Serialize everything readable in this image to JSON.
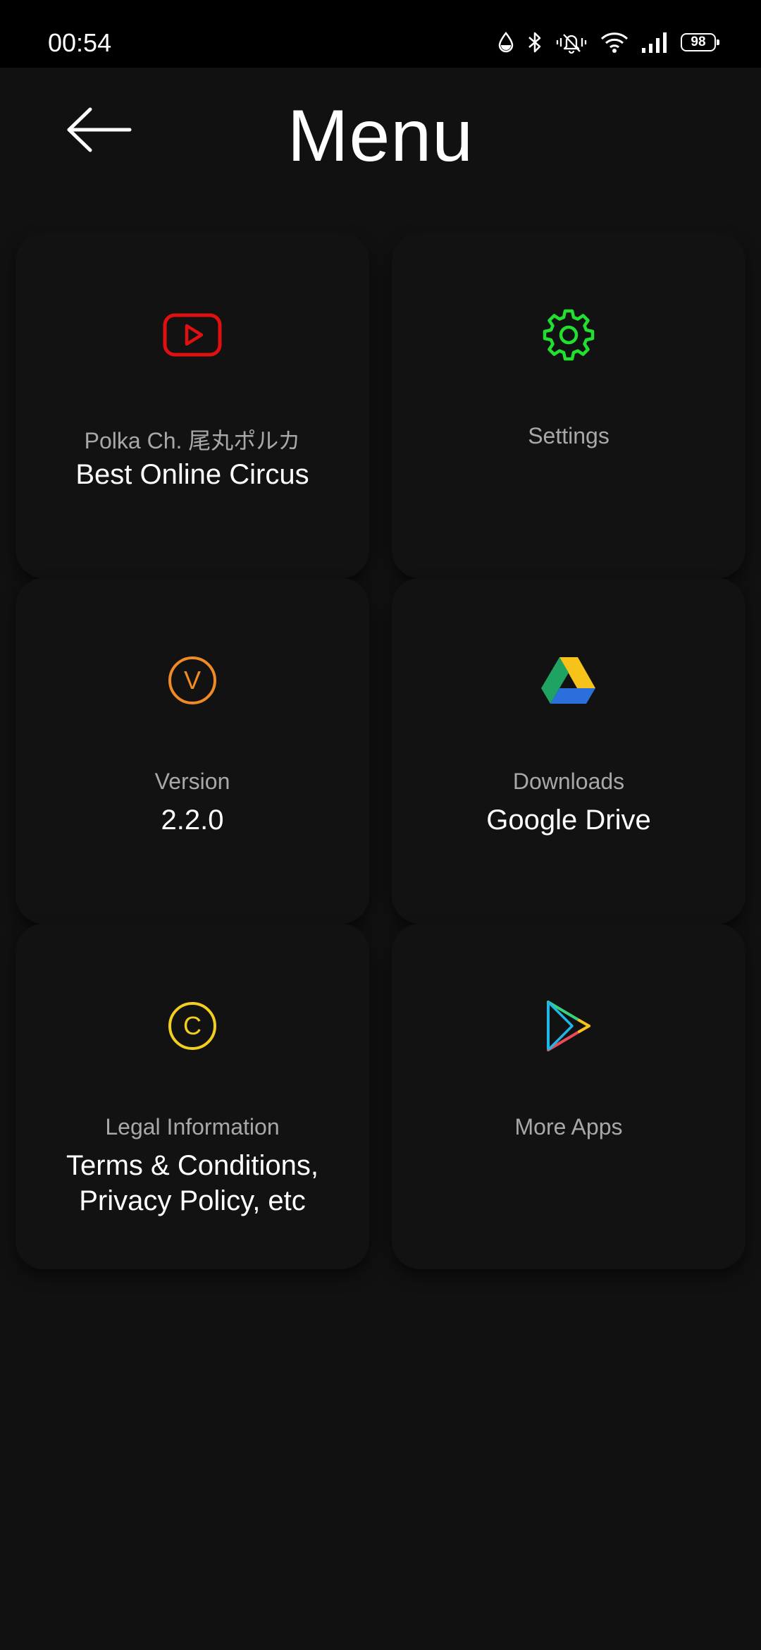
{
  "status_bar": {
    "time": "00:54",
    "battery": "98",
    "icons": [
      "water-drop-icon",
      "bluetooth-icon",
      "vibrate-icon",
      "wifi-icon",
      "signal-icon",
      "battery-icon"
    ]
  },
  "header": {
    "title": "Menu",
    "back_icon": "arrow-left-icon"
  },
  "cards": {
    "channel": {
      "icon": "youtube-icon",
      "icon_color": "#e01010",
      "subtitle": "Polka Ch. 尾丸ポルカ",
      "title": "Best Online Circus"
    },
    "settings": {
      "icon": "gear-icon",
      "icon_color": "#22e030",
      "subtitle": "Settings",
      "title": ""
    },
    "version": {
      "icon": "v-circle-icon",
      "icon_letter": "V",
      "icon_color": "#f08a24",
      "subtitle": "Version",
      "title": "2.2.0"
    },
    "downloads": {
      "icon": "google-drive-icon",
      "subtitle": "Downloads",
      "title": "Google Drive"
    },
    "legal": {
      "icon": "c-circle-icon",
      "icon_letter": "C",
      "icon_color": "#f2cf1f",
      "subtitle": "Legal Information",
      "title": "Terms & Conditions,\nPrivacy Policy, etc"
    },
    "more_apps": {
      "icon": "play-store-icon",
      "subtitle": "More Apps",
      "title": ""
    }
  }
}
